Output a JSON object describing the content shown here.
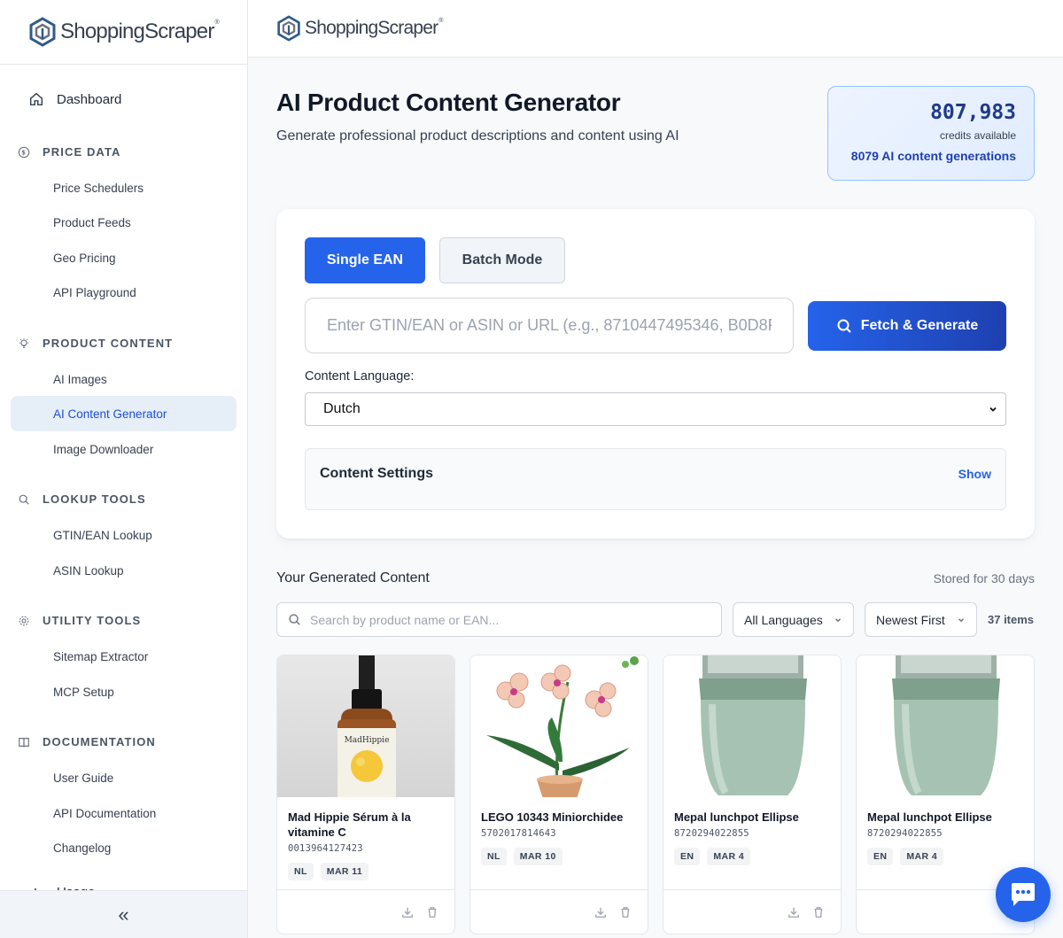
{
  "brand": {
    "name": "ShoppingScraper",
    "mark": "®"
  },
  "sidebar": {
    "dashboard": "Dashboard",
    "sections": [
      {
        "title": "PRICE DATA",
        "items": [
          "Price Schedulers",
          "Product Feeds",
          "Geo Pricing",
          "API Playground"
        ]
      },
      {
        "title": "PRODUCT CONTENT",
        "items": [
          "AI Images",
          "AI Content Generator",
          "Image Downloader"
        ]
      },
      {
        "title": "LOOKUP TOOLS",
        "items": [
          "GTIN/EAN Lookup",
          "ASIN Lookup"
        ]
      },
      {
        "title": "UTILITY TOOLS",
        "items": [
          "Sitemap Extractor",
          "MCP Setup"
        ]
      },
      {
        "title": "DOCUMENTATION",
        "items": [
          "User Guide",
          "API Documentation",
          "Changelog"
        ]
      }
    ],
    "usage": "Usage",
    "collapse": "«"
  },
  "page": {
    "title": "AI Product Content Generator",
    "subtitle": "Generate professional product descriptions and content using AI"
  },
  "credits": {
    "amount": "807,983",
    "label": "credits available",
    "generations": "8079 AI content generations"
  },
  "form": {
    "tab_single": "Single EAN",
    "tab_batch": "Batch Mode",
    "input_placeholder": "Enter GTIN/EAN or ASIN or URL (e.g., 8710447495346, B0D8F",
    "fetch_label": "Fetch & Generate",
    "language_label": "Content Language:",
    "language_value": "Dutch",
    "settings_title": "Content Settings",
    "settings_toggle": "Show"
  },
  "generated": {
    "title": "Your Generated Content",
    "stored": "Stored for 30 days",
    "search_placeholder": "Search by product name or EAN...",
    "lang_filter": "All Languages",
    "sort": "Newest First",
    "count": "37 items"
  },
  "products": [
    {
      "name": "Mad Hippie Sérum à la vitamine C",
      "ean": "0013964127423",
      "lang": "NL",
      "date": "MAR 11",
      "label": "MadHippie"
    },
    {
      "name": "LEGO 10343 Miniorchidee",
      "ean": "5702017814643",
      "lang": "NL",
      "date": "MAR 10"
    },
    {
      "name": "Mepal lunchpot Ellipse",
      "ean": "8720294022855",
      "lang": "EN",
      "date": "MAR 4"
    },
    {
      "name": "Mepal lunchpot Ellipse",
      "ean": "8720294022855",
      "lang": "EN",
      "date": "MAR 4"
    }
  ],
  "colors": {
    "primary": "#2563eb",
    "primary_dark": "#1e40af",
    "active_nav_bg": "#e6eef8"
  }
}
